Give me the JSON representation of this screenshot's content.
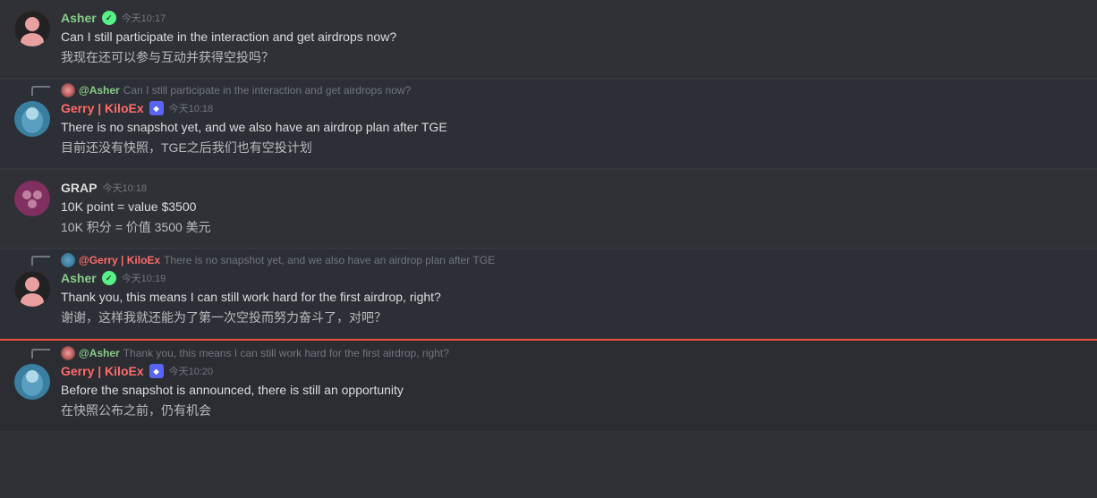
{
  "messages": [
    {
      "id": "msg1",
      "type": "message",
      "author": "Asher",
      "authorClass": "asher",
      "badge": "verified",
      "timestamp": "今天10:17",
      "text_en": "Can I still participate in the interaction and get airdrops now?",
      "text_cn": "我现在还可以参与互动并获得空投吗？"
    },
    {
      "id": "msg2",
      "type": "reply-message",
      "reply_author": "@Asher",
      "reply_text": "Can I still participate in the interaction and get airdrops now?",
      "author": "Gerry | KiloEx",
      "authorClass": "gerry",
      "badge": "kiloex",
      "timestamp": "今天10:18",
      "text_en": "There is no snapshot yet, and we also have an airdrop plan after TGE",
      "text_cn": "目前还没有快照，TGE之后我们也有空投计划"
    },
    {
      "id": "msg3",
      "type": "message",
      "author": "GRAP",
      "authorClass": "grap",
      "badge": "none",
      "timestamp": "今天10:18",
      "text_en": "10K point = value $3500",
      "text_cn": "10K 积分 = 价值 3500 美元"
    },
    {
      "id": "msg4",
      "type": "reply-message",
      "reply_author": "@Gerry | KiloEx",
      "reply_text": "There is no snapshot yet, and we also have an airdrop plan after TGE",
      "author": "Asher",
      "authorClass": "asher",
      "badge": "verified",
      "timestamp": "今天10:19",
      "text_en": "Thank you, this means I can still work hard for the first airdrop, right?",
      "text_cn": "谢谢，这样我就还能为了第一次空投而努力奋斗了，对吧？"
    },
    {
      "id": "msg5",
      "type": "reply-message",
      "reply_author": "@Asher",
      "reply_text": "Thank you, this means I can still work hard for the first airdrop, right?",
      "author": "Gerry | KiloEx",
      "authorClass": "gerry",
      "badge": "kiloex",
      "timestamp": "今天10:20",
      "text_en": "Before the snapshot is announced, there is still an opportunity",
      "text_cn": "在快照公布之前，仍有机会"
    }
  ]
}
